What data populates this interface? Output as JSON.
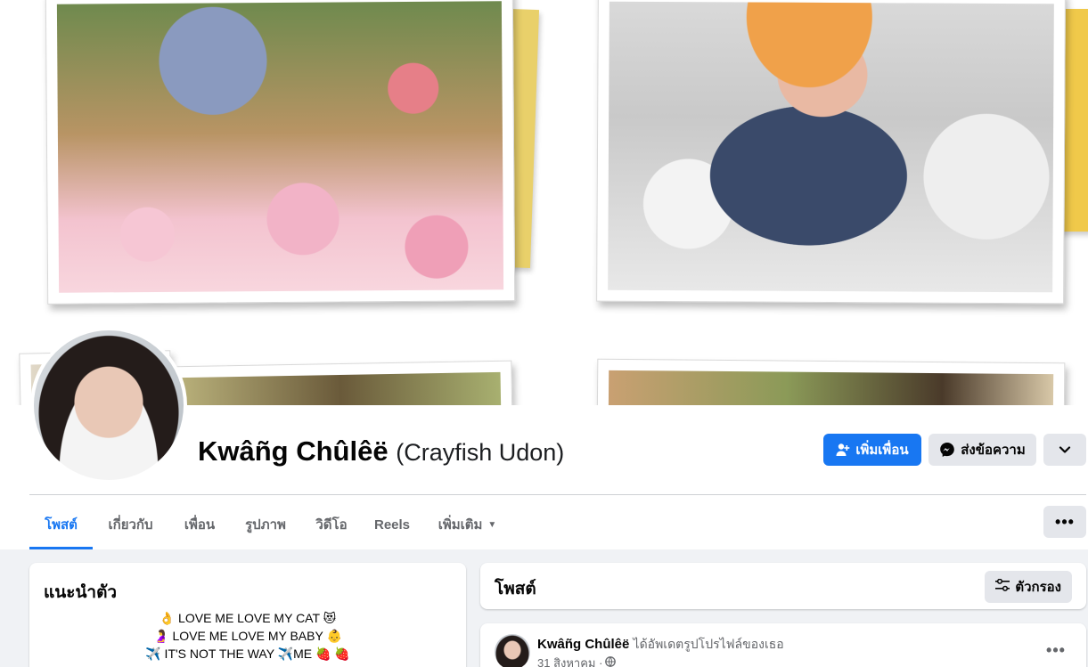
{
  "profile": {
    "name": "Kwâñg Chûlêë",
    "alt_name": "(Crayfish Udon)"
  },
  "actions": {
    "add_friend": "เพิ่มเพื่อน",
    "message": "ส่งข้อความ"
  },
  "tabs": [
    {
      "label": "โพสต์"
    },
    {
      "label": "เกี่ยวกับ"
    },
    {
      "label": "เพื่อน"
    },
    {
      "label": "รูปภาพ"
    },
    {
      "label": "วิดีโอ"
    },
    {
      "label": "Reels"
    },
    {
      "label": "เพิ่มเติม"
    }
  ],
  "more_dots": "•••",
  "intro": {
    "title": "แนะนำตัว",
    "bio": [
      "👌 LOVE ME LOVE MY CAT 😻",
      "🤰 LOVE ME LOVE MY BABY 👶",
      "✈️ IT'S NOT THE WAY ✈️ME 🍓 🍓"
    ]
  },
  "posts_section": {
    "title": "โพสต์",
    "filter_label": "ตัวกรอง"
  },
  "post": {
    "author": "Kwâñg Chûlêë",
    "action": "ได้อัพเดตรูปโปรไฟล์ของเธอ",
    "date": "31 สิงหาคม ·"
  },
  "colors": {
    "accent": "#1877f2",
    "button_bg": "#e4e6eb",
    "page_bg": "#f0f2f5"
  }
}
